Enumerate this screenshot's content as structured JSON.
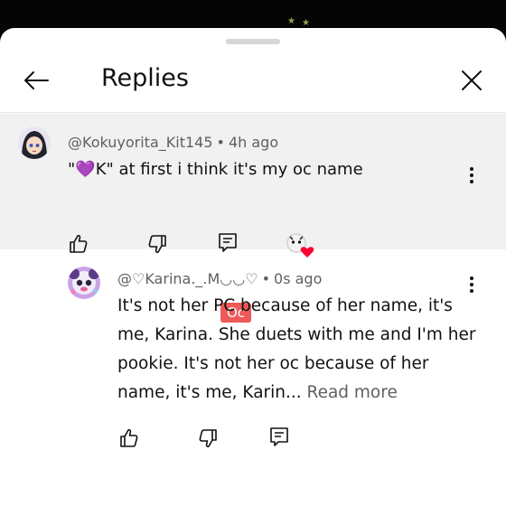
{
  "header": {
    "title": "Replies"
  },
  "parent_comment": {
    "author": "@Kokuyorita_Kit145",
    "time": "4h ago",
    "text": "\"💜K\" at first i think it's my oc name"
  },
  "reply": {
    "author": "@♡Karina._.M◡◡♡",
    "time": "0s ago",
    "text": "It's not her PC because of her name, it's me, Karina. She duets with me and I'm her pookie. It's not her oc because of her name, it's me, Karin...",
    "read_more": "Read more",
    "overlay_badge": "Oc"
  },
  "separator": "•",
  "colors": {
    "heart": "#ff0033",
    "badge": "#ee5a5a",
    "parent_bg": "#f1f1f1"
  },
  "icons": [
    "back-arrow-icon",
    "close-icon",
    "more-vert-icon",
    "thumbs-up-icon",
    "thumbs-down-icon",
    "reply-comment-icon",
    "creator-heart-icon"
  ]
}
